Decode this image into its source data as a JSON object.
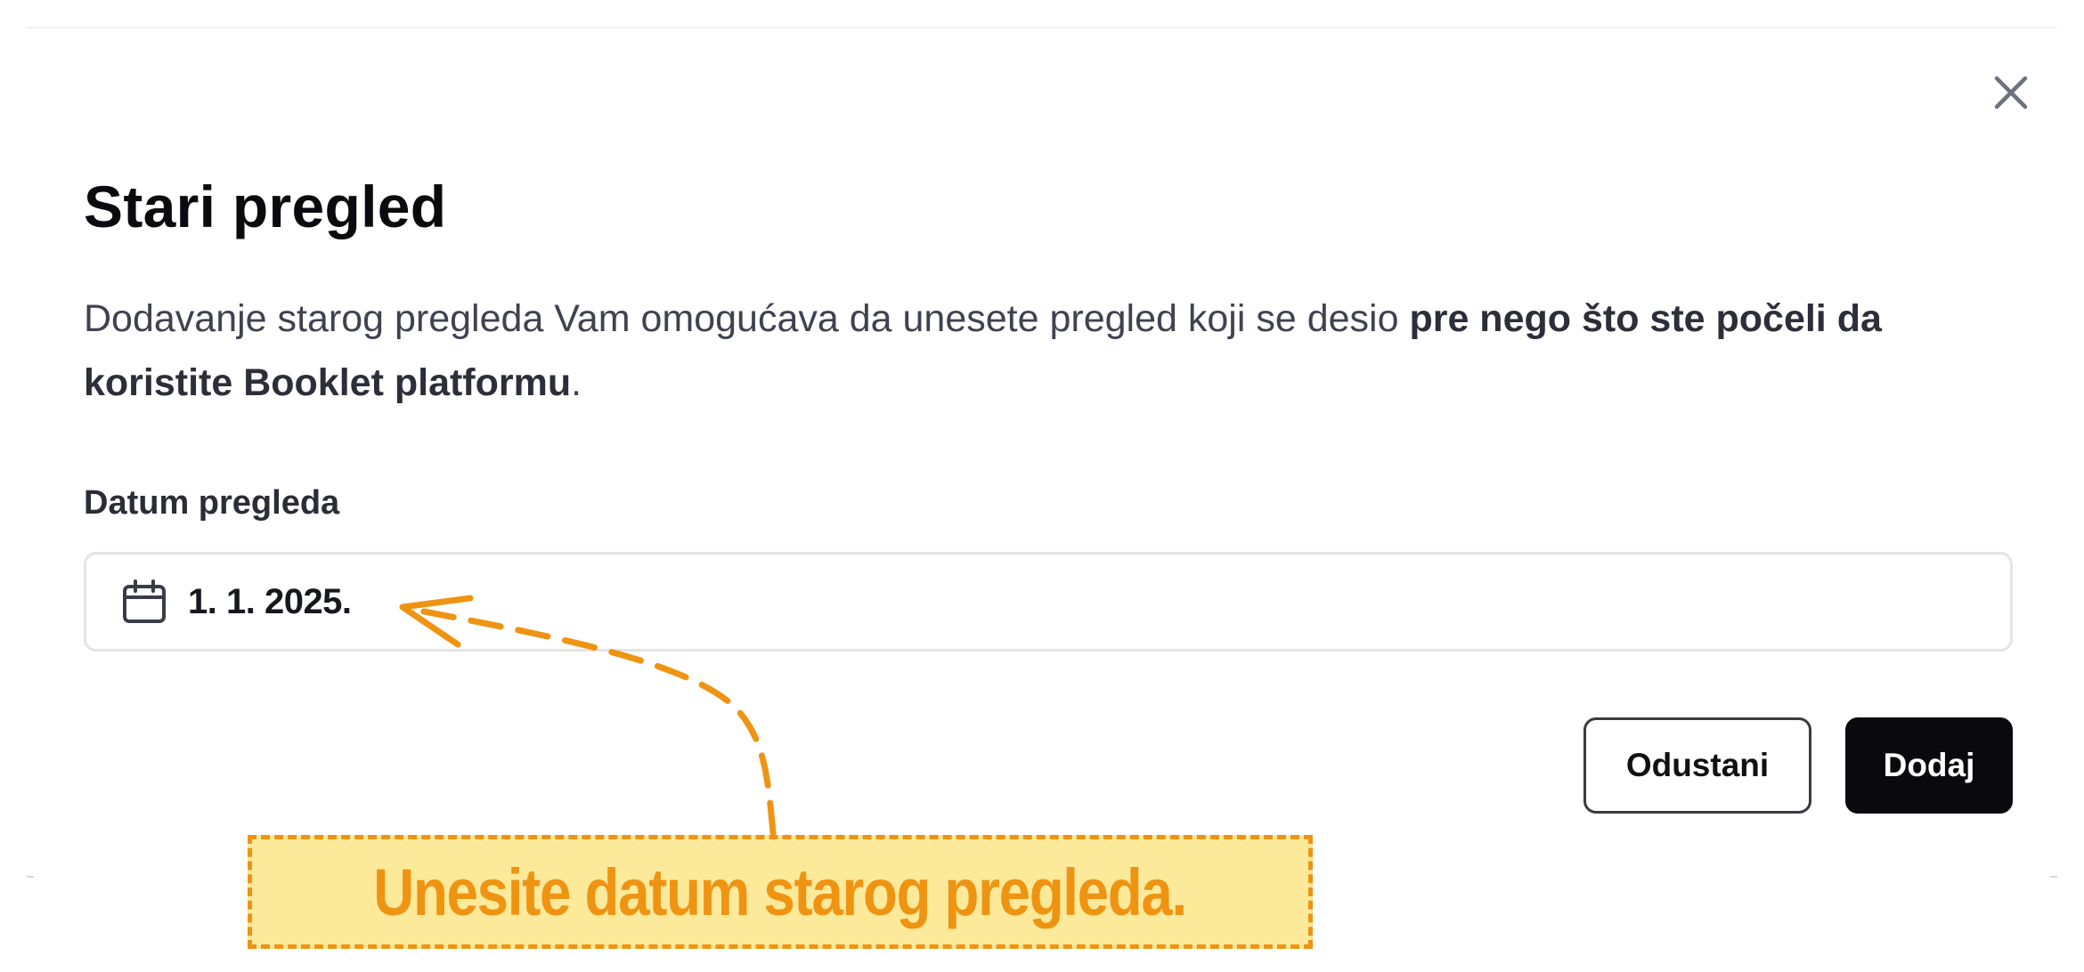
{
  "dialog": {
    "title": "Stari pregled",
    "description_normal": "Dodavanje starog pregleda Vam omogućava da unesete pregled koji se desio ",
    "description_bold": "pre nego što ste počeli da koristite Booklet platformu",
    "description_end": ".",
    "close_icon": "close-icon"
  },
  "form": {
    "date_label": "Datum pregleda",
    "date_value": "1. 1. 2025.",
    "date_icon": "calendar-icon"
  },
  "actions": {
    "cancel_label": "Odustani",
    "add_label": "Dodaj"
  },
  "annotation": {
    "text": "Unesite datum starog pregleda.",
    "color": "#ee9412",
    "fill": "#fde99a"
  }
}
